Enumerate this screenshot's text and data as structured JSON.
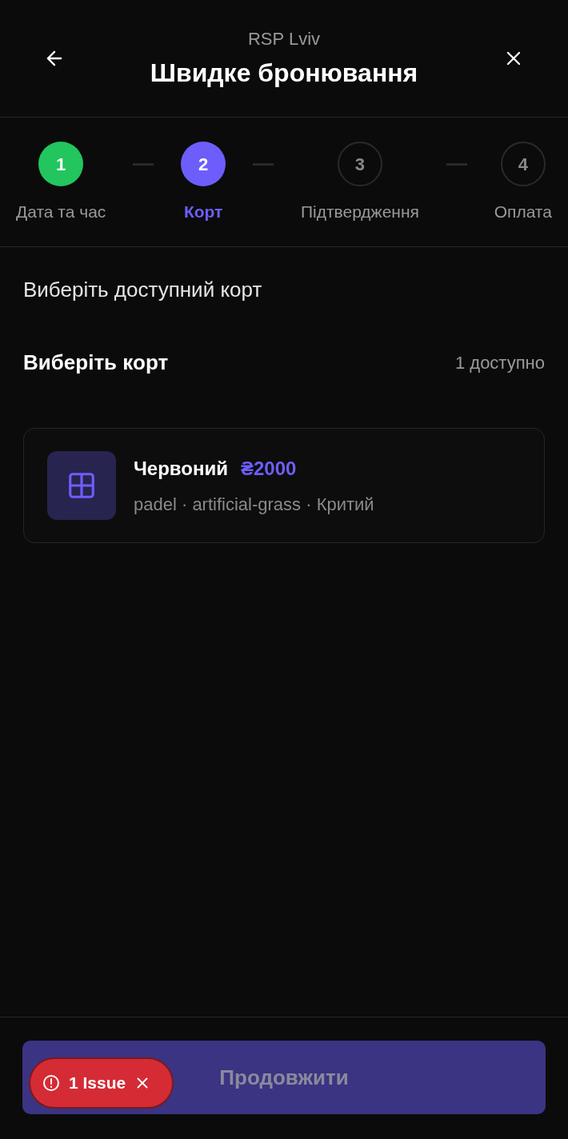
{
  "header": {
    "subtitle": "RSP Lviv",
    "title": "Швидке бронювання"
  },
  "steps": [
    {
      "number": "1",
      "label": "Дата та час",
      "kind": "done"
    },
    {
      "number": "2",
      "label": "Корт",
      "kind": "current"
    },
    {
      "number": "3",
      "label": "Підтвердження",
      "kind": "upcoming"
    },
    {
      "number": "4",
      "label": "Оплата",
      "kind": "upcoming"
    }
  ],
  "prompt": "Виберіть доступний корт",
  "section": {
    "title": "Виберіть корт",
    "count": "1 доступно"
  },
  "courts": [
    {
      "name": "Червоний",
      "price": "₴2000",
      "details": "padel · artificial-grass · Критий",
      "selected": false
    }
  ],
  "continue_button": {
    "label": "Продовжити",
    "disabled": true
  },
  "issue_badge": {
    "label": "1 Issue"
  }
}
